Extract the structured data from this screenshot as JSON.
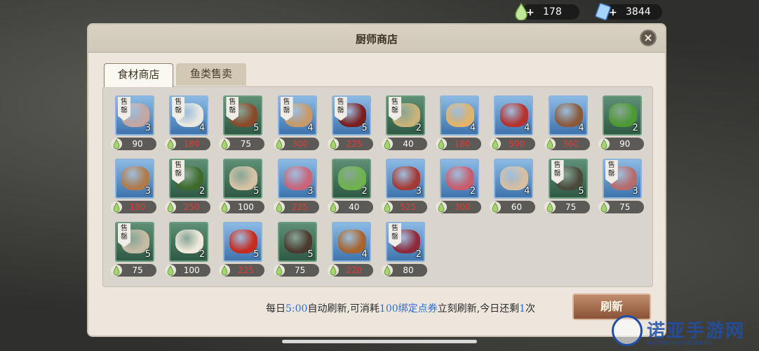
{
  "currencies": [
    {
      "value": "178",
      "icon": "drop-icon",
      "color": "#9ed36a"
    },
    {
      "value": "3844",
      "icon": "ticket-icon",
      "color": "#8fc6ff"
    }
  ],
  "window": {
    "title": "厨师商店",
    "close_icon": "close-icon"
  },
  "tabs": [
    {
      "label": "食材商店",
      "active": true
    },
    {
      "label": "鱼类售卖",
      "active": false
    }
  ],
  "soldout_label": "售罄",
  "items": [
    {
      "qty": "3",
      "price": "90",
      "red": false,
      "soldout": true,
      "frame": "blue",
      "food": "#c4a7a0"
    },
    {
      "qty": "4",
      "price": "180",
      "red": true,
      "soldout": true,
      "frame": "blue",
      "food": "#e8e8e0"
    },
    {
      "qty": "5",
      "price": "75",
      "red": false,
      "soldout": true,
      "frame": "green",
      "food": "#8a4a2a"
    },
    {
      "qty": "4",
      "price": "300",
      "red": true,
      "soldout": true,
      "frame": "blue",
      "food": "#c89a6a"
    },
    {
      "qty": "5",
      "price": "225",
      "red": true,
      "soldout": true,
      "frame": "blue",
      "food": "#7a1e1e"
    },
    {
      "qty": "2",
      "price": "40",
      "red": false,
      "soldout": true,
      "frame": "green",
      "food": "#c9b37a"
    },
    {
      "qty": "4",
      "price": "180",
      "red": true,
      "soldout": false,
      "frame": "blue",
      "food": "#e2b468"
    },
    {
      "qty": "4",
      "price": "500",
      "red": true,
      "soldout": false,
      "frame": "blue",
      "food": "#b6312f"
    },
    {
      "qty": "4",
      "price": "360",
      "red": true,
      "soldout": false,
      "frame": "blue",
      "food": "#8a5a3a"
    },
    {
      "qty": "2",
      "price": "90",
      "red": false,
      "soldout": false,
      "frame": "green",
      "food": "#4c9a34"
    },
    {
      "qty": "3",
      "price": "180",
      "red": true,
      "soldout": false,
      "frame": "blue",
      "food": "#b07a4a"
    },
    {
      "qty": "2",
      "price": "250",
      "red": true,
      "soldout": true,
      "frame": "green",
      "food": "#3e6a2a"
    },
    {
      "qty": "5",
      "price": "100",
      "red": false,
      "soldout": false,
      "frame": "green",
      "food": "#d6c3a6"
    },
    {
      "qty": "3",
      "price": "225",
      "red": true,
      "soldout": false,
      "frame": "blue",
      "food": "#c9657a"
    },
    {
      "qty": "2",
      "price": "40",
      "red": false,
      "soldout": false,
      "frame": "green",
      "food": "#6fb34c"
    },
    {
      "qty": "3",
      "price": "525",
      "red": true,
      "soldout": false,
      "frame": "blue",
      "food": "#a53a34"
    },
    {
      "qty": "2",
      "price": "300",
      "red": true,
      "soldout": false,
      "frame": "blue",
      "food": "#c85c6c"
    },
    {
      "qty": "4",
      "price": "60",
      "red": false,
      "soldout": false,
      "frame": "blue",
      "food": "#d8bfa0"
    },
    {
      "qty": "5",
      "price": "75",
      "red": false,
      "soldout": true,
      "frame": "green",
      "food": "#4a4a3c"
    },
    {
      "qty": "3",
      "price": "75",
      "red": false,
      "soldout": true,
      "frame": "blue",
      "food": "#b76a6a"
    },
    {
      "qty": "5",
      "price": "75",
      "red": false,
      "soldout": true,
      "frame": "green",
      "food": "#c6bca4"
    },
    {
      "qty": "2",
      "price": "100",
      "red": false,
      "soldout": false,
      "frame": "green",
      "food": "#f1eadc"
    },
    {
      "qty": "5",
      "price": "225",
      "red": true,
      "soldout": false,
      "frame": "blue",
      "food": "#c92a20"
    },
    {
      "qty": "5",
      "price": "75",
      "red": false,
      "soldout": false,
      "frame": "green",
      "food": "#4a3a30"
    },
    {
      "qty": "4",
      "price": "220",
      "red": true,
      "soldout": false,
      "frame": "blue",
      "food": "#a8642a"
    },
    {
      "qty": "2",
      "price": "80",
      "red": false,
      "soldout": true,
      "frame": "blue",
      "food": "#8f2a3a"
    }
  ],
  "refresh": {
    "prefix": "每日",
    "time": "5:00",
    "mid": "自动刷新,可消耗",
    "cost": "100绑定点券",
    "mid2": "立刻刷新,今日还剩",
    "remaining": "1",
    "suffix": "次",
    "button_label": "刷新"
  },
  "watermark": {
    "text": "诺亚手游网",
    "sub": "NUOYASHOUYOUWANG"
  }
}
